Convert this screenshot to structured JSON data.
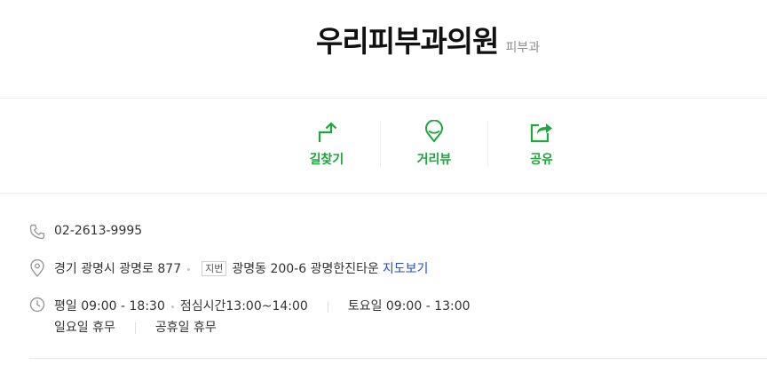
{
  "place": {
    "name": "우리피부과의원",
    "category": "피부과"
  },
  "actions": [
    {
      "label": "길찾기",
      "icon": "directions-icon"
    },
    {
      "label": "거리뷰",
      "icon": "street-view-pin-icon"
    },
    {
      "label": "공유",
      "icon": "share-icon"
    }
  ],
  "info": {
    "phone": "02-2613-9995",
    "address": "경기 광명시 광명로 877",
    "lot_badge": "지번",
    "lot_address": "광명동 200-6 광명한진타운",
    "map_link": "지도보기",
    "hours": {
      "weekday": "평일 09:00 - 18:30",
      "lunch": "점심시간13:00~14:00",
      "saturday": "토요일 09:00 - 13:00",
      "sunday": "일요일 휴무",
      "holiday": "공휴일 휴무"
    }
  },
  "colors": {
    "accent": "#1ea73c",
    "link": "#1f4bd6",
    "muted": "#8e8e8e"
  }
}
